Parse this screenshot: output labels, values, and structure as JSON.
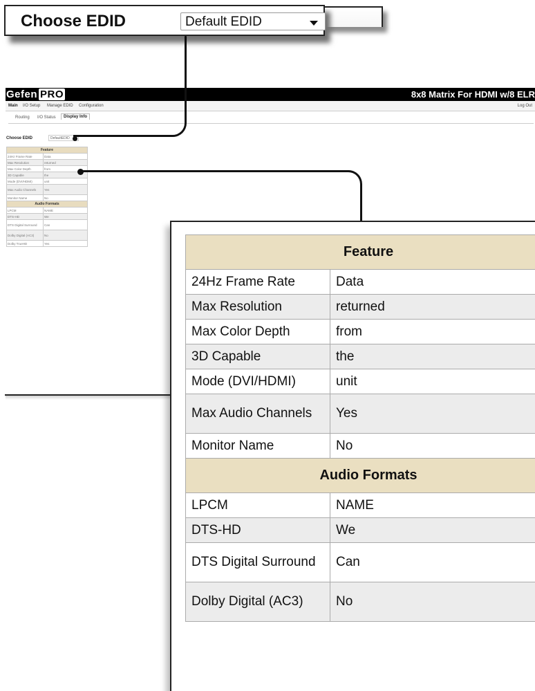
{
  "callout": {
    "label": "Choose EDID",
    "select_value": "Default EDID"
  },
  "app": {
    "logo_main": "Gefen",
    "logo_pro": "PRO",
    "title": "8x8 Matrix For HDMI w/8 ELR",
    "menu": [
      "Main",
      "I/O Setup",
      "Manage EDID",
      "Configuration"
    ],
    "logout": "Log Out",
    "tabs": [
      "Routing",
      "I/O Status",
      "Display Info"
    ],
    "active_tab": "Display Info",
    "choose_label": "Choose EDID",
    "choose_value": "DefaultEDID"
  },
  "table": {
    "feature_header": "Feature",
    "feature_rows": [
      {
        "key": "24Hz Frame Rate",
        "value": "Data"
      },
      {
        "key": "Max Resolution",
        "value": "returned"
      },
      {
        "key": "Max Color Depth",
        "value": "from"
      },
      {
        "key": "3D Capable",
        "value": "the"
      },
      {
        "key": "Mode (DVI/HDMI)",
        "value": "unit"
      },
      {
        "key": "Max Audio Channels",
        "value": "Yes"
      },
      {
        "key": "Monitor Name",
        "value": "No"
      }
    ],
    "audio_header": "Audio Formats",
    "audio_rows": [
      {
        "key": "LPCM",
        "value": "NAME"
      },
      {
        "key": "DTS-HD",
        "value": "We"
      },
      {
        "key": "DTS Digital Surround",
        "value": "Can"
      },
      {
        "key": "Dolby Digital (AC3)",
        "value": "No"
      },
      {
        "key": "Dolby TrueHD",
        "value": "Yes"
      }
    ]
  }
}
